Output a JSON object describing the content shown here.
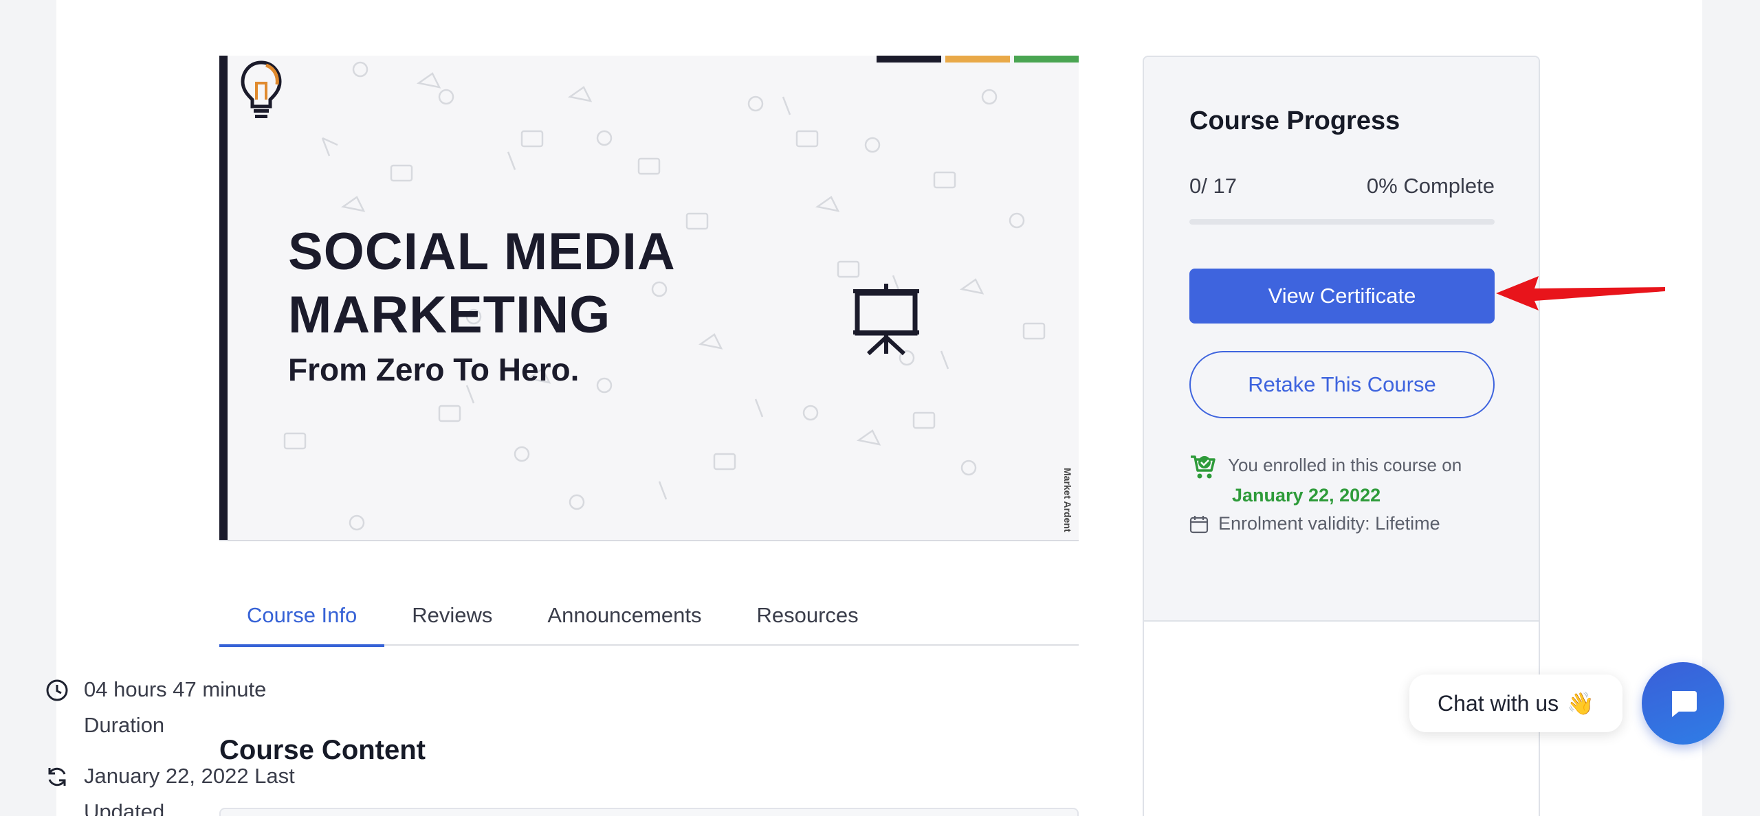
{
  "banner": {
    "title_line1": "SOCIAL MEDIA",
    "title_line2": "MARKETING",
    "subtitle": "From Zero To Hero.",
    "brand": "Market Ardent",
    "stripe_colors": [
      "#1b1b2b",
      "#e9a948",
      "#4aa552"
    ]
  },
  "tabs": [
    {
      "label": "Course Info",
      "active": true
    },
    {
      "label": "Reviews",
      "active": false
    },
    {
      "label": "Announcements",
      "active": false
    },
    {
      "label": "Resources",
      "active": false
    }
  ],
  "course_content": {
    "heading": "Course Content"
  },
  "sidebar": {
    "title": "Course Progress",
    "progress_count": "0/ 17",
    "progress_percent_label": "0% Complete",
    "progress_fraction": 0,
    "view_certificate": "View Certificate",
    "retake": "Retake This Course",
    "enrolled_text": "You enrolled in this course on",
    "enrolled_date": "January 22, 2022",
    "validity": "Enrolment validity: Lifetime",
    "duration_value": "04 hours  47 minute",
    "duration_label": "Duration",
    "last_updated": "January 22, 2022 Last",
    "last_updated_label": "Updated"
  },
  "chat": {
    "label": "Chat with us",
    "emoji": "👋"
  },
  "colors": {
    "accent": "#3e64de",
    "success": "#2e9b3a",
    "arrow": "#e8141b"
  }
}
